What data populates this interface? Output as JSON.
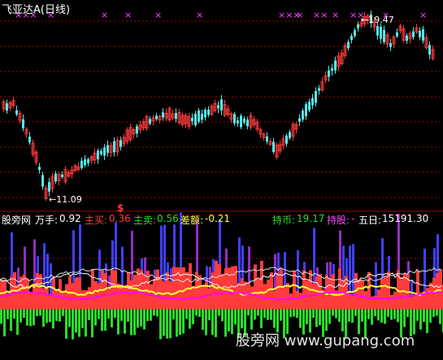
{
  "title": "飞亚达A(日线)",
  "price_panel": {
    "high_label": "19.47",
    "low_label": "11.09",
    "signal_marker": "$",
    "top_markers": [
      "×××",
      "×",
      "×",
      "×",
      "×",
      "×",
      "×××",
      "×",
      "××",
      "×",
      "××",
      "×",
      "×"
    ]
  },
  "indicator_header": {
    "name": "股旁网",
    "wan_label": "万手:",
    "wan_value": "0.92",
    "zhumai_label": "主买:",
    "zhumai_value": "0.36",
    "zhumai2_label": "主卖:",
    "zhumai2_value": "0.56",
    "diff_label": "差额:",
    "diff_value": "-0.21",
    "chibi_label": "持币:",
    "chibi_value": "19.17",
    "chigu_label": "持股:",
    "chigu_value": "-",
    "wuri_label": "五日:",
    "wuri_value": "15191.30"
  },
  "watermark": "股旁网 www.gupang.com",
  "colors": {
    "up": "#ff3b3b",
    "down": "#54e8e8",
    "grid": "#a00000",
    "marker": "#ff44ff",
    "yellow": "#ffff3c",
    "green": "#28dc28",
    "blue": "#4040ff",
    "magenta": "#ff00ff"
  }
}
